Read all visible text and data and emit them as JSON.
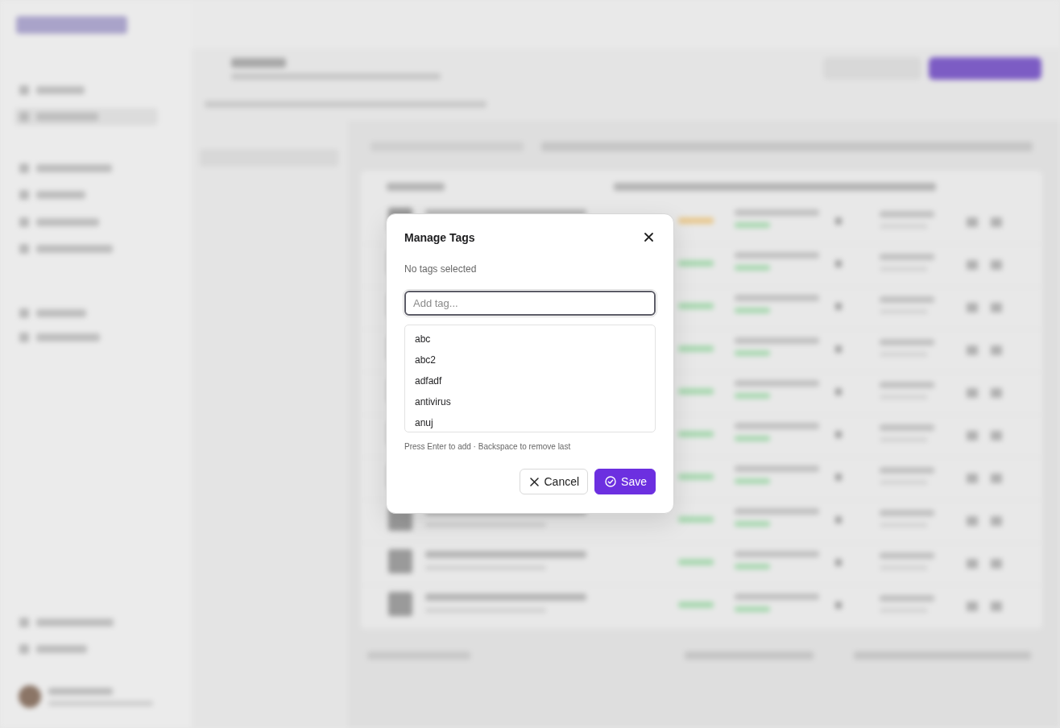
{
  "dialog": {
    "title": "Manage Tags",
    "status_text": "No tags selected",
    "input": {
      "placeholder": "Add tag..."
    },
    "suggestions": [
      {
        "label": "abc"
      },
      {
        "label": "abc2"
      },
      {
        "label": "adfadf"
      },
      {
        "label": "antivirus"
      },
      {
        "label": "anuj"
      }
    ],
    "hint": "Press Enter to add · Backspace to remove last",
    "buttons": [
      {
        "kind": "cancel",
        "label": "Cancel"
      },
      {
        "kind": "save",
        "label": "Save"
      }
    ]
  }
}
